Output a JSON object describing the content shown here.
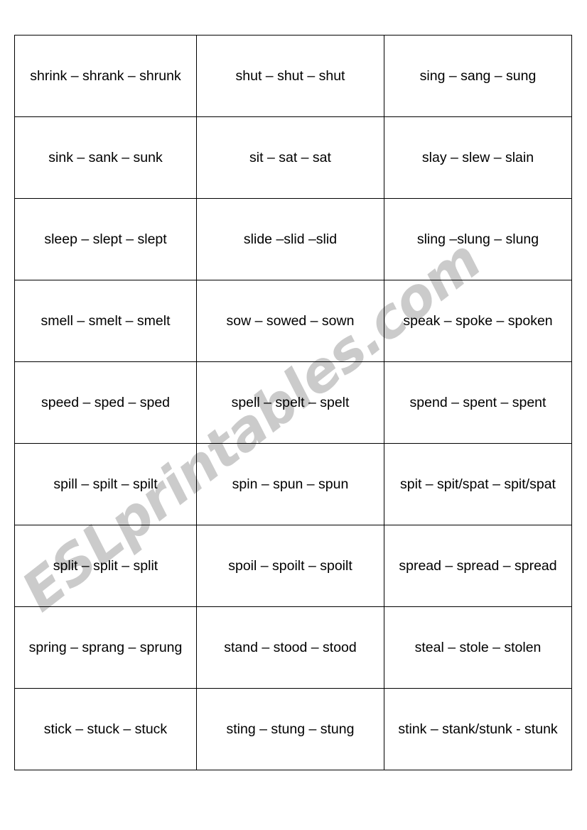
{
  "document": {
    "type": "worksheet-table",
    "title": "Irregular verbs (s-) three forms table",
    "background_color": "#ffffff",
    "text_color": "#000000",
    "border_color": "#000000"
  },
  "watermark": {
    "text": "ESLprintables.com",
    "color": "#cbcbcb",
    "rotation_deg": -38
  },
  "table": {
    "columns": 3,
    "rows": 9,
    "cells": [
      [
        "shrink – shrank – shrunk",
        "shut – shut – shut",
        "sing – sang – sung"
      ],
      [
        "sink – sank – sunk",
        "sit – sat – sat",
        "slay – slew – slain"
      ],
      [
        "sleep – slept – slept",
        "slide –slid –slid",
        "sling –slung – slung"
      ],
      [
        "smell – smelt – smelt",
        "sow – sowed – sown",
        "speak – spoke – spoken"
      ],
      [
        "speed – sped – sped",
        "spell – spelt – spelt",
        "spend – spent – spent"
      ],
      [
        "spill – spilt – spilt",
        "spin – spun – spun",
        "spit – spit/spat – spit/spat"
      ],
      [
        "split – split – split",
        "spoil – spoilt – spoilt",
        "spread – spread – spread"
      ],
      [
        "spring – sprang – sprung",
        "stand – stood – stood",
        "steal – stole – stolen"
      ],
      [
        "stick – stuck – stuck",
        "sting – stung – stung",
        "stink – stank/stunk - stunk"
      ]
    ]
  }
}
